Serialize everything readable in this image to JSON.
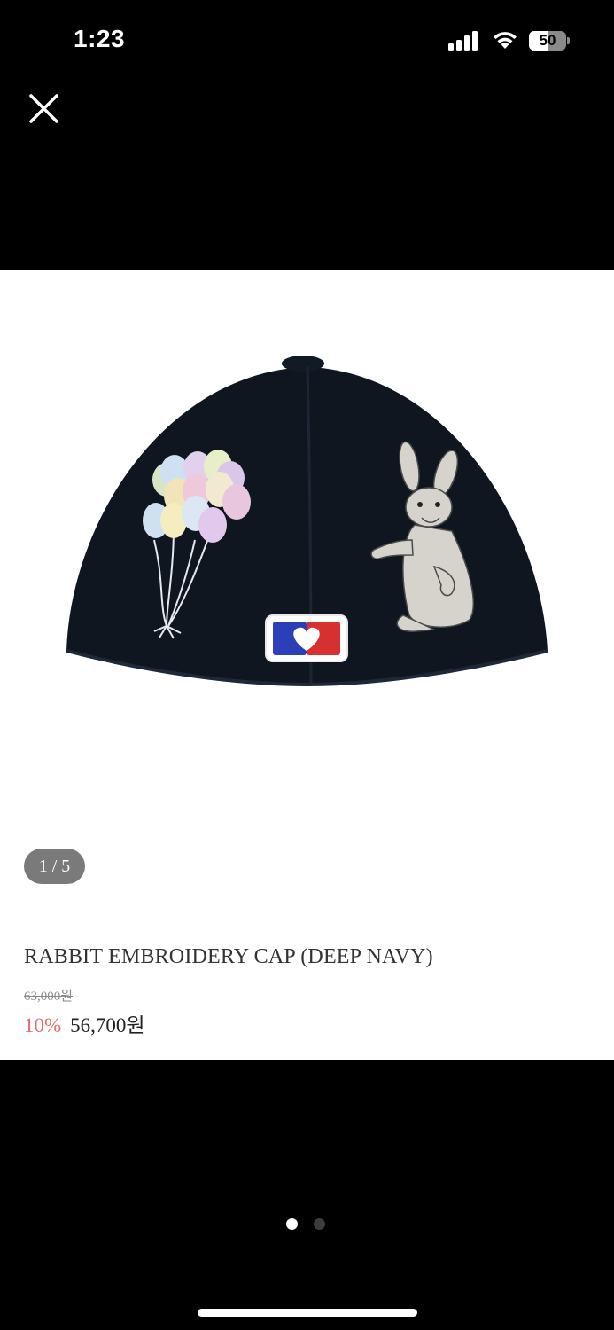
{
  "status_bar": {
    "time": "1:23",
    "battery_level": "50",
    "battery_fraction": 0.5,
    "icons": [
      "signal-icon",
      "wifi-icon",
      "battery-icon"
    ]
  },
  "close_icon": "close-icon",
  "gallery": {
    "counter": "1 / 5",
    "image": "navy cap back view with balloon and rabbit embroidery",
    "pager": {
      "total": 2,
      "active_index": 0
    }
  },
  "product": {
    "title": "RABBIT EMBROIDERY CAP (DEEP NAVY)",
    "original_price": "63,000원",
    "discount": "10%",
    "sale_price": "56,700원"
  },
  "colors": {
    "background": "#000000",
    "sheet": "#ffffff",
    "discount": "#e06b6b",
    "cap_navy": "#0f1620",
    "badge": "#7a7a7a"
  }
}
